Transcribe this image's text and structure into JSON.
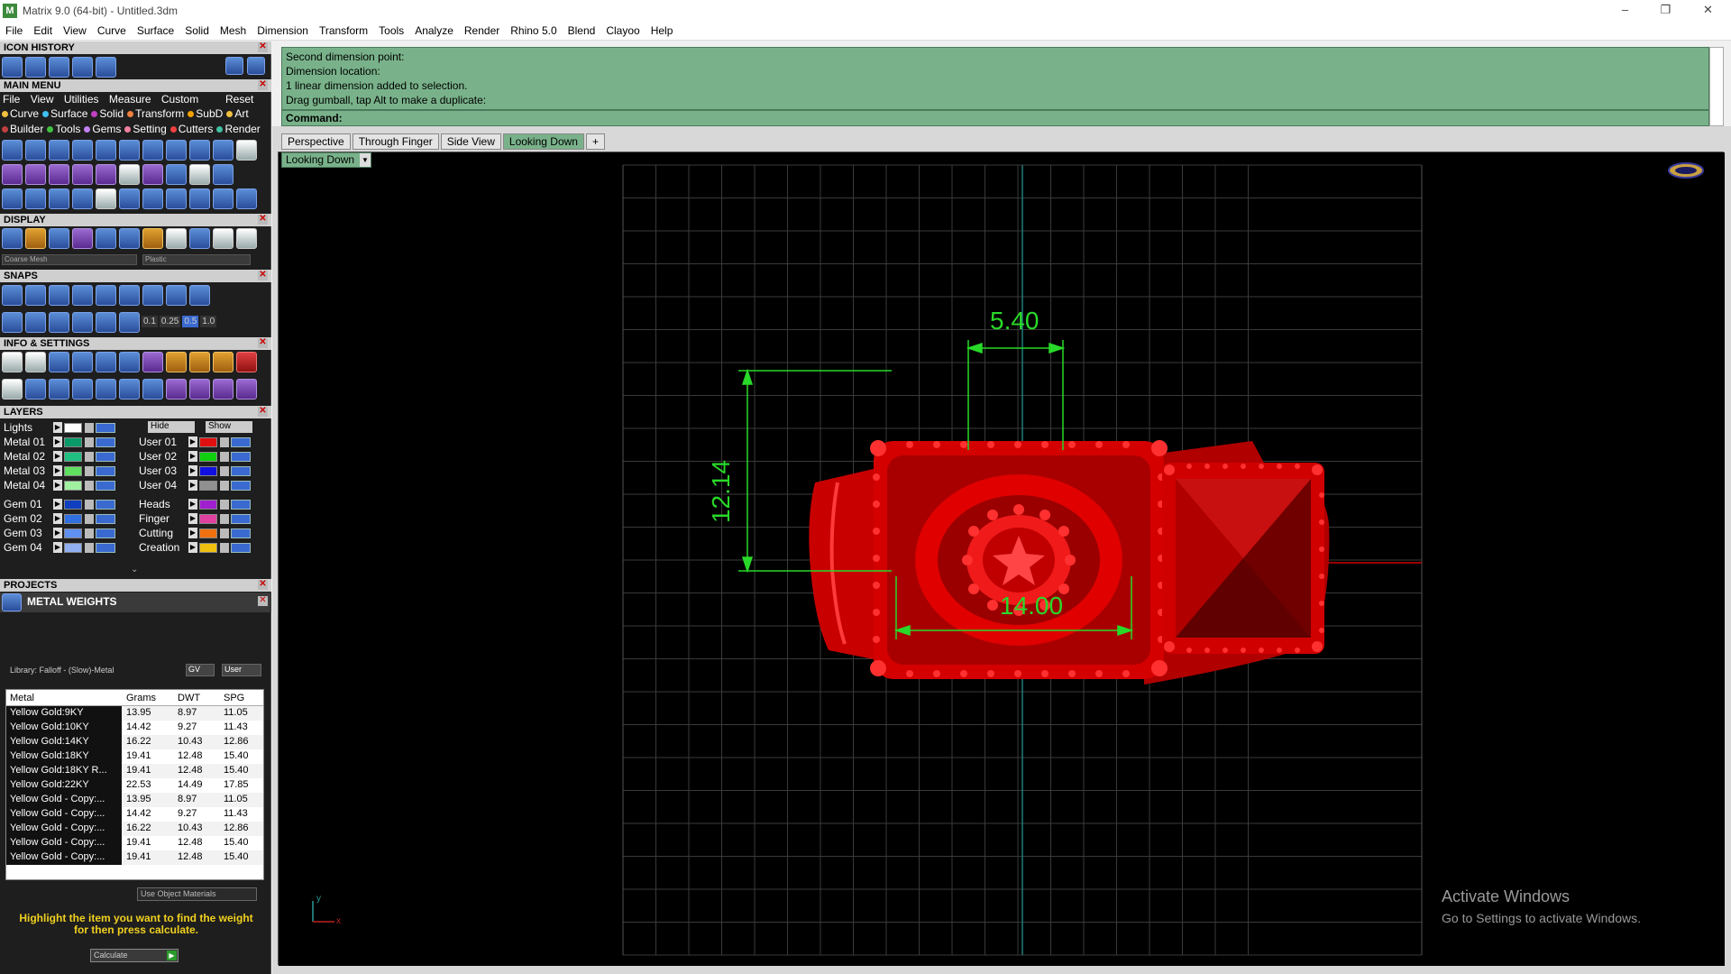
{
  "window": {
    "title": "Matrix 9.0 (64-bit) - Untitled.3dm",
    "minimize": "–",
    "maximize": "❐",
    "close": "✕"
  },
  "menubar": [
    "File",
    "Edit",
    "View",
    "Curve",
    "Surface",
    "Solid",
    "Mesh",
    "Dimension",
    "Transform",
    "Tools",
    "Analyze",
    "Render",
    "Rhino 5.0",
    "Blend",
    "Clayoo",
    "Help"
  ],
  "panels": {
    "icon_history": "ICON HISTORY",
    "main_menu": "MAIN MENU",
    "display": "DISPLAY",
    "snaps": "SNAPS",
    "info_settings": "INFO & SETTINGS",
    "layers": "LAYERS",
    "projects": "PROJECTS",
    "close_glyph": "✕"
  },
  "main_menu": {
    "items": [
      "File",
      "View",
      "Utilities",
      "Measure",
      "Custom"
    ],
    "reset": "Reset",
    "categories_row1": [
      {
        "label": "Curve",
        "color": "#f0c040"
      },
      {
        "label": "Surface",
        "color": "#40c0f0"
      },
      {
        "label": "Solid",
        "color": "#c040c0"
      },
      {
        "label": "Transform",
        "color": "#f08040"
      },
      {
        "label": "SubD",
        "color": "#f0a000"
      },
      {
        "label": "Art",
        "color": "#f0c040"
      }
    ],
    "categories_row2": [
      {
        "label": "Builder",
        "color": "#c04040"
      },
      {
        "label": "Tools",
        "color": "#40c040"
      },
      {
        "label": "Gems",
        "color": "#c080f0"
      },
      {
        "label": "Setting",
        "color": "#f080a0"
      },
      {
        "label": "Cutters",
        "color": "#f04040"
      },
      {
        "label": "Render",
        "color": "#40c0a0"
      }
    ]
  },
  "display": {
    "mesh": "Coarse Mesh",
    "material": "Plastic"
  },
  "snaps": {
    "values": [
      "0.1",
      "0.25",
      "0.5",
      "1.0"
    ]
  },
  "layers": {
    "lights": "Lights",
    "hide": "Hide",
    "show": "Show",
    "left": [
      {
        "name": "Metal 01",
        "color": "#0a9a6a"
      },
      {
        "name": "Metal 02",
        "color": "#20c080"
      },
      {
        "name": "Metal 03",
        "color": "#60e060"
      },
      {
        "name": "Metal 04",
        "color": "#a0f0a0"
      },
      {
        "name": "Gem 01",
        "color": "#1040c0"
      },
      {
        "name": "Gem 02",
        "color": "#3070e0"
      },
      {
        "name": "Gem 03",
        "color": "#6090f0"
      },
      {
        "name": "Gem 04",
        "color": "#90b0f0"
      }
    ],
    "right": [
      {
        "name": "User 01",
        "color": "#e01010"
      },
      {
        "name": "User 02",
        "color": "#10d010"
      },
      {
        "name": "User 03",
        "color": "#1010e0"
      },
      {
        "name": "User 04",
        "color": "#909090"
      },
      {
        "name": "Heads",
        "color": "#a020d0"
      },
      {
        "name": "Finger",
        "color": "#e040a0"
      },
      {
        "name": "Cutting",
        "color": "#f07010"
      },
      {
        "name": "Creation",
        "color": "#f0c010"
      }
    ]
  },
  "metal_weights": {
    "title": "METAL WEIGHTS",
    "library": "Library: Falloff - (Slow)-Metal",
    "gv": "GV",
    "user": "User",
    "columns": [
      "Metal",
      "Grams",
      "DWT",
      "SPG"
    ],
    "rows": [
      [
        "Yellow Gold:9KY",
        "13.95",
        "8.97",
        "11.05"
      ],
      [
        "Yellow Gold:10KY",
        "14.42",
        "9.27",
        "11.43"
      ],
      [
        "Yellow Gold:14KY",
        "16.22",
        "10.43",
        "12.86"
      ],
      [
        "Yellow Gold:18KY",
        "19.41",
        "12.48",
        "15.40"
      ],
      [
        "Yellow Gold:18KY R...",
        "19.41",
        "12.48",
        "15.40"
      ],
      [
        "Yellow Gold:22KY",
        "22.53",
        "14.49",
        "17.85"
      ],
      [
        "Yellow Gold - Copy:...",
        "13.95",
        "8.97",
        "11.05"
      ],
      [
        "Yellow Gold - Copy:...",
        "14.42",
        "9.27",
        "11.43"
      ],
      [
        "Yellow Gold - Copy:...",
        "16.22",
        "10.43",
        "12.86"
      ],
      [
        "Yellow Gold - Copy:...",
        "19.41",
        "12.48",
        "15.40"
      ],
      [
        "Yellow Gold - Copy:...",
        "19.41",
        "12.48",
        "15.40"
      ]
    ],
    "use_object_materials": "Use Object Materials",
    "hint": "Highlight the item you want to find the weight for then press calculate.",
    "calculate": "Calculate"
  },
  "command_history": [
    "Second dimension point:",
    "Dimension location:",
    "1 linear dimension added to selection.",
    "Drag gumball, tap Alt to make a duplicate:"
  ],
  "command_prompt": "Command:",
  "tabs": [
    "Perspective",
    "Through Finger",
    "Side View",
    "Looking Down"
  ],
  "tab_add": "+",
  "active_view": "Looking Down",
  "dimensions": {
    "top": "5.40",
    "left": "12.14",
    "bottom": "14.00"
  },
  "axis": {
    "x": "x",
    "y": "y"
  },
  "watermark": {
    "line1": "Activate Windows",
    "line2": "Go to Settings to activate Windows."
  },
  "colors": {
    "command_bg": "#79b28a",
    "ring": "#e00000",
    "dimension": "#29d929",
    "grid": "#3a3a3a"
  }
}
